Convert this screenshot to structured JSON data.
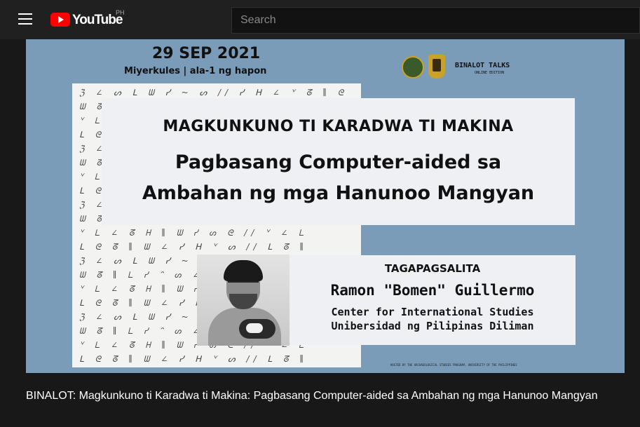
{
  "header": {
    "menu_icon": "hamburger-menu-icon",
    "logo_text": "YouTube",
    "country_code": "PH",
    "search_placeholder": "Search"
  },
  "video": {
    "thumbnail": {
      "date": "29 SEP 2021",
      "time": "Miyerkules | ala-1 ng hapon",
      "series": "BINALOT TALKS",
      "series_edition": "ONLINE EDITION",
      "headline": "MAGKUNKUNO TI KARADWA TI MAKINA",
      "subtitle_line1": "Pagbasang Computer-aided sa",
      "subtitle_line2": "Ambahan ng mga Hanunoo Mangyan",
      "speaker_label": "TAGAPAGSALITA",
      "speaker_name": "Ramon \"Bomen\" Guillermo",
      "affiliation_line1": "Center for International Studies",
      "affiliation_line2": "Unibersidad ng Pilipinas Diliman",
      "footer_note": "HOSTED BY THE ARCHAEOLOGICAL STUDIES PROGRAM, UNIVERSITY OF THE PHILIPPINES"
    },
    "title": "BINALOT: Magkunkuno ti Karadwa ti Makina: Pagbasang Computer-aided sa Ambahan ng mga Hanunoo Mangyan"
  },
  "colors": {
    "page_bg": "#181818",
    "topbar_bg": "#202020",
    "brand_red": "#ff0000",
    "thumbnail_bg": "#7b9cb8"
  }
}
